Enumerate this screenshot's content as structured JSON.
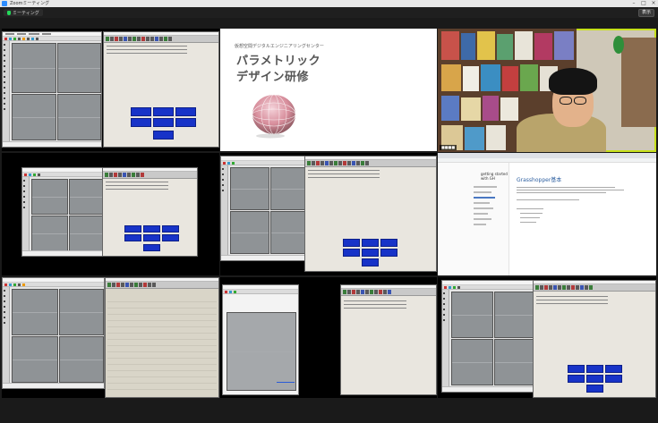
{
  "window": {
    "title": "Zoomミーティング",
    "minimize": "–",
    "maximize": "□",
    "close": "×"
  },
  "meeting": {
    "label": "ミーティング",
    "view_button": "表示"
  },
  "slide": {
    "subtitle": "仮想空間デジタルエンジニアリングセンター",
    "title_line1": "パラメトリック",
    "title_line2": "デザイン研修"
  },
  "doc": {
    "brand_line1": "getting started",
    "brand_line2": "with GH",
    "heading": "Grasshopper基本"
  },
  "tiles": {
    "gh_button_label": "GH Player"
  },
  "colors": {
    "active_speaker": "#c6e01a",
    "button_blue": "#1733c8",
    "background": "#1a1a1a"
  }
}
